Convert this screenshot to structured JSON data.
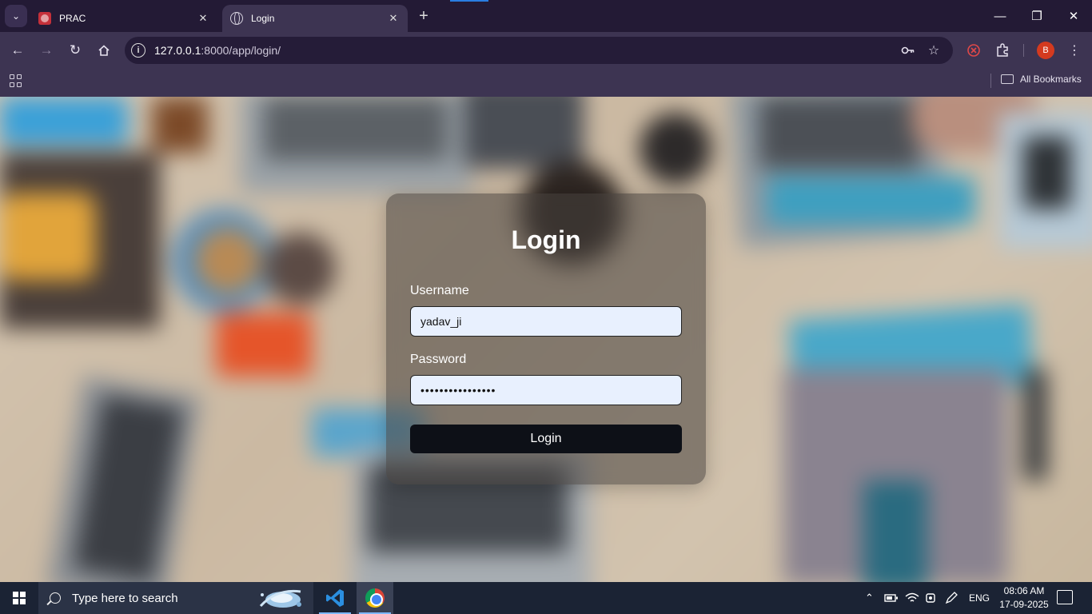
{
  "browser": {
    "tabs": [
      {
        "title": "PRAC",
        "active": false
      },
      {
        "title": "Login",
        "active": true
      }
    ],
    "url_host": "127.0.0.1",
    "url_rest": ":8000/app/login/",
    "bookmarks_label": "All Bookmarks",
    "profile_initial": "B"
  },
  "login": {
    "title": "Login",
    "username_label": "Username",
    "username_value": "yadav_ji",
    "password_label": "Password",
    "password_value": "••••••••••••••••",
    "submit_label": "Login"
  },
  "taskbar": {
    "search_placeholder": "Type here to search",
    "language": "ENG",
    "time": "08:06 AM",
    "date": "17-09-2025"
  },
  "colors": {
    "tab_bar": "#231a35",
    "toolbar": "#3d3452",
    "omnibox": "#251c38",
    "login_button": "#0d1017",
    "input_bg": "#e8f0fe",
    "taskbar": "#1b2334",
    "profile_avatar": "#d43a1f"
  }
}
